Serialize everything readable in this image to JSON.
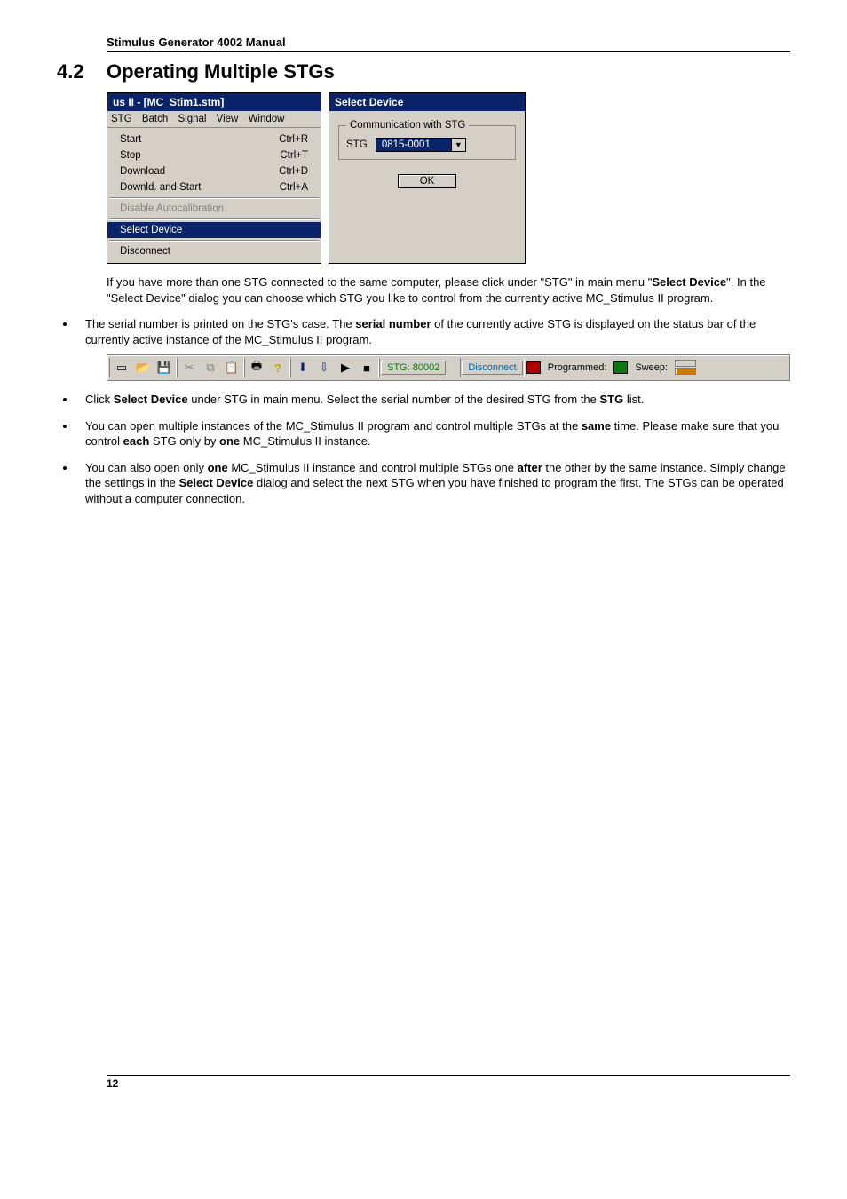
{
  "header": {
    "running": "Stimulus Generator 4002 Manual",
    "section_number": "4.2",
    "section_title": "Operating Multiple STGs"
  },
  "stgmenu": {
    "title": "us II - [MC_Stim1.stm]",
    "menubar": [
      "STG",
      "Batch",
      "Signal",
      "View",
      "Window"
    ],
    "items": {
      "start": {
        "label": "Start",
        "accel": "Ctrl+R"
      },
      "stop": {
        "label": "Stop",
        "accel": "Ctrl+T"
      },
      "download": {
        "label": "Download",
        "accel": "Ctrl+D"
      },
      "downld_start": {
        "label": "Downld. and Start",
        "accel": "Ctrl+A"
      },
      "disable_autocal": {
        "label": "Disable Autocalibration"
      },
      "select_device": {
        "label": "Select Device"
      },
      "disconnect": {
        "label": "Disconnect"
      }
    }
  },
  "dialog": {
    "title": "Select Device",
    "fieldset_legend": "Communication with STG",
    "field_label": "STG",
    "combo_value": "0815-0001",
    "ok_label": "OK"
  },
  "para1_a": "If you have more than one STG connected to the same computer, please click under \"STG\" in main menu \"",
  "para1_b": "Select Device",
  "para1_c": "\". In the \"Select Device\" dialog you can choose which STG you like to control from the currently active MC_Stimulus II program.",
  "b1_a": "The serial number is printed on the STG's case. The ",
  "b1_b": "serial number",
  "b1_c": " of the currently active STG is displayed on the status bar of the currently active instance of the MC_Stimulus II program.",
  "toolbar": {
    "stg": "STG: 80002",
    "disconnect": "Disconnect",
    "programmed": "Programmed:",
    "sweep": "Sweep:"
  },
  "b2_a": "Click ",
  "b2_b": "Select Device",
  "b2_c": " under STG in main menu. Select the serial number of the desired STG from the ",
  "b2_d": "STG",
  "b2_e": " list.",
  "b3_a": "You can open multiple instances of the MC_Stimulus II program and control multiple STGs at the ",
  "b3_b": "same",
  "b3_c": " time. Please make sure that you control ",
  "b3_d": "each",
  "b3_e": " STG only by ",
  "b3_f": "one",
  "b3_g": " MC_Stimulus II instance.",
  "b4_a": "You can also open only ",
  "b4_b": "one",
  "b4_c": " MC_Stimulus II instance and control multiple STGs one ",
  "b4_d": "after",
  "b4_e": " the other by the same instance. Simply change the settings in the ",
  "b4_f": "Select Device",
  "b4_g": " dialog and select the next STG when you have finished to program the first. The STGs can be operated without a computer connection.",
  "page_number": "12"
}
